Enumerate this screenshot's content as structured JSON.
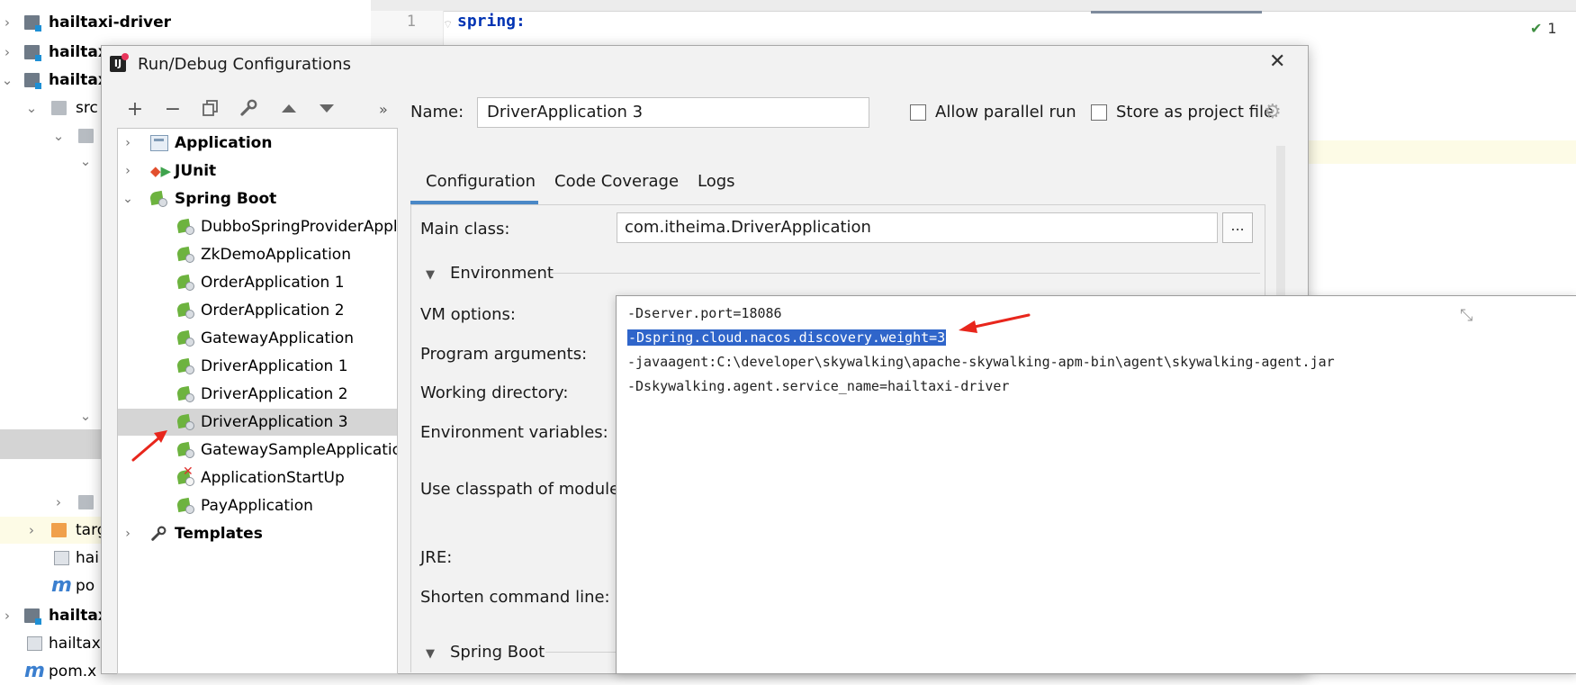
{
  "project_tree": {
    "rows": [
      {
        "label": "hailtaxi-driver"
      },
      {
        "label": "hailtax"
      },
      {
        "label": "hailtax"
      },
      {
        "label": "src"
      },
      {
        "label": "targ"
      },
      {
        "label": "hai"
      },
      {
        "label": "po"
      },
      {
        "label": "hailtax"
      },
      {
        "label": "hailtaxi"
      },
      {
        "label": "pom.x"
      }
    ]
  },
  "editor": {
    "line_number": "1",
    "code_text": "spring:",
    "inspection_count": "1"
  },
  "dialog": {
    "title": "Run/Debug Configurations",
    "toolbar": {
      "add_icon": "plus-icon",
      "remove_icon": "minus-icon",
      "copy_icon": "copy-icon",
      "edit_icon": "wrench-icon",
      "up_icon": "arrow-up-icon",
      "down_icon": "arrow-down-icon",
      "overflow_label": "»"
    },
    "config_tree": {
      "application": "Application",
      "junit": "JUnit",
      "spring_boot": "Spring Boot",
      "spring_items": [
        "DubboSpringProviderAppli",
        "ZkDemoApplication",
        "OrderApplication 1",
        "OrderApplication 2",
        "GatewayApplication",
        "DriverApplication 1",
        "DriverApplication 2",
        "DriverApplication 3",
        "GatewaySampleApplication",
        "ApplicationStartUp",
        "PayApplication"
      ],
      "selected": "DriverApplication 3",
      "templates": "Templates"
    },
    "name_label": "Name:",
    "name_value": "DriverApplication 3",
    "allow_parallel_label": "Allow parallel run",
    "allow_parallel_checked": false,
    "store_as_project_label": "Store as project file",
    "store_as_project_checked": false,
    "tabs": [
      "Configuration",
      "Code Coverage",
      "Logs"
    ],
    "active_tab": "Configuration",
    "main_class_label": "Main class:",
    "main_class_value": "com.itheima.DriverApplication",
    "browse_label": "...",
    "environment_label": "Environment",
    "vm_options_label": "VM options:",
    "program_arguments_label": "Program arguments:",
    "working_directory_label": "Working directory:",
    "environment_variables_label": "Environment variables:",
    "classpath_label": "Use classpath of module:",
    "jre_label": "JRE:",
    "shorten_label": "Shorten command line:",
    "spring_boot_section": "Spring Boot",
    "vm_options_lines": [
      "-Dserver.port=18086",
      "-Dspring.cloud.nacos.discovery.weight=3",
      "-javaagent:C:\\developer\\skywalking\\apache-skywalking-apm-bin\\agent\\skywalking-agent.jar",
      "-Dskywalking.agent.service_name=hailtaxi-driver"
    ],
    "vm_selected_line": 1
  },
  "colors": {
    "selection_blue": "#2f65ca",
    "tab_accent": "#4a88c7",
    "annotation_red": "#e8261c",
    "spring_green": "#6db33f"
  }
}
